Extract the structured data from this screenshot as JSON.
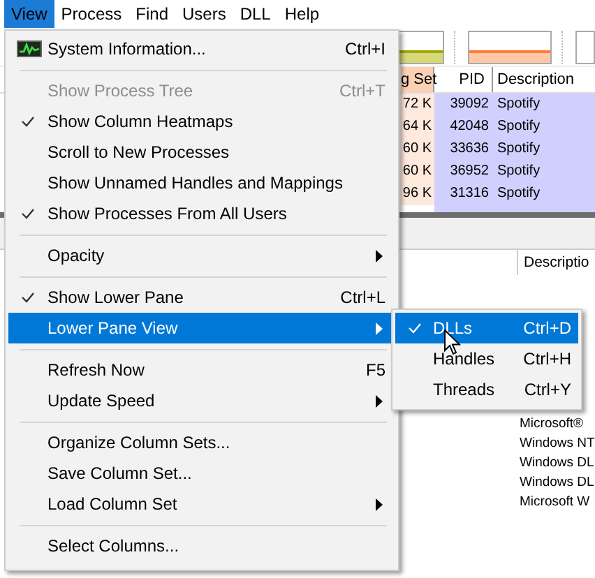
{
  "menubar": [
    {
      "label": "View",
      "selected": true
    },
    {
      "label": "Process",
      "selected": false
    },
    {
      "label": "Find",
      "selected": false
    },
    {
      "label": "Users",
      "selected": false
    },
    {
      "label": "DLL",
      "selected": false
    },
    {
      "label": "Help",
      "selected": false
    }
  ],
  "process_table": {
    "columns": [
      "g Set",
      "PID",
      "Description"
    ],
    "rows": [
      {
        "working_set": "72 K",
        "pid": "39092",
        "description": "Spotify"
      },
      {
        "working_set": "64 K",
        "pid": "42048",
        "description": "Spotify"
      },
      {
        "working_set": "60 K",
        "pid": "33636",
        "description": "Spotify"
      },
      {
        "working_set": "60 K",
        "pid": "36952",
        "description": "Spotify"
      },
      {
        "working_set": "96 K",
        "pid": "31316",
        "description": "Spotify"
      }
    ]
  },
  "lower_pane": {
    "column": "Descriptio",
    "rows": [
      "Microsoft®",
      "Windows NT",
      "Windows DL",
      "Windows DL",
      "Microsoft W"
    ]
  },
  "view_menu": {
    "items": [
      {
        "kind": "icon-item",
        "label": "System Information...",
        "shortcut": "Ctrl+I",
        "disabled": false,
        "selected": false,
        "submenu": false
      },
      {
        "kind": "separator"
      },
      {
        "kind": "item",
        "label": "Show Process Tree",
        "shortcut": "Ctrl+T",
        "checked": false,
        "disabled": true,
        "selected": false,
        "submenu": false
      },
      {
        "kind": "item",
        "label": "Show Column Heatmaps",
        "checked": true,
        "disabled": false,
        "selected": false,
        "submenu": false
      },
      {
        "kind": "item",
        "label": "Scroll to New Processes",
        "checked": false,
        "disabled": false,
        "selected": false,
        "submenu": false
      },
      {
        "kind": "item",
        "label": "Show Unnamed Handles and Mappings",
        "checked": false,
        "disabled": false,
        "selected": false,
        "submenu": false
      },
      {
        "kind": "item",
        "label": "Show Processes From All Users",
        "checked": true,
        "disabled": false,
        "selected": false,
        "submenu": false
      },
      {
        "kind": "separator"
      },
      {
        "kind": "item",
        "label": "Opacity",
        "checked": false,
        "disabled": false,
        "selected": false,
        "submenu": true
      },
      {
        "kind": "separator"
      },
      {
        "kind": "item",
        "label": "Show Lower Pane",
        "shortcut": "Ctrl+L",
        "checked": true,
        "disabled": false,
        "selected": false,
        "submenu": false
      },
      {
        "kind": "item",
        "label": "Lower Pane View",
        "checked": false,
        "disabled": false,
        "selected": true,
        "submenu": true
      },
      {
        "kind": "separator"
      },
      {
        "kind": "item",
        "label": "Refresh Now",
        "shortcut": "F5",
        "checked": false,
        "disabled": false,
        "selected": false,
        "submenu": false
      },
      {
        "kind": "item",
        "label": "Update Speed",
        "checked": false,
        "disabled": false,
        "selected": false,
        "submenu": true
      },
      {
        "kind": "separator"
      },
      {
        "kind": "item",
        "label": "Organize Column Sets...",
        "checked": false,
        "disabled": false,
        "selected": false,
        "submenu": false
      },
      {
        "kind": "item",
        "label": "Save Column Set...",
        "checked": false,
        "disabled": false,
        "selected": false,
        "submenu": false
      },
      {
        "kind": "item",
        "label": "Load Column Set",
        "checked": false,
        "disabled": false,
        "selected": false,
        "submenu": true
      },
      {
        "kind": "separator"
      },
      {
        "kind": "item",
        "label": "Select Columns...",
        "checked": false,
        "disabled": false,
        "selected": false,
        "submenu": false
      }
    ]
  },
  "lower_pane_view_menu": {
    "items": [
      {
        "label": "DLLs",
        "shortcut": "Ctrl+D",
        "checked": true,
        "selected": true
      },
      {
        "label": "Handles",
        "shortcut": "Ctrl+H",
        "checked": false,
        "selected": false
      },
      {
        "label": "Threads",
        "shortcut": "Ctrl+Y",
        "checked": false,
        "selected": false
      }
    ]
  }
}
